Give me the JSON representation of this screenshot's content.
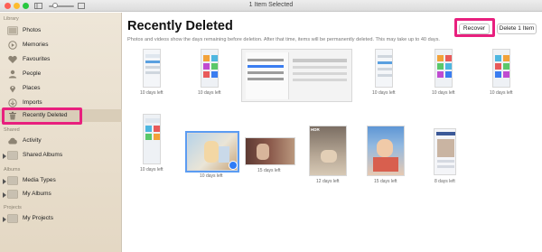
{
  "window": {
    "title": "1 Item Selected"
  },
  "sidebar": {
    "sections": {
      "library": "Library",
      "shared": "Shared",
      "albums": "Albums",
      "projects": "Projects"
    },
    "library_items": [
      {
        "label": "Photos",
        "icon": "photos-icon"
      },
      {
        "label": "Memories",
        "icon": "memories-icon"
      },
      {
        "label": "Favourites",
        "icon": "heart-icon"
      },
      {
        "label": "People",
        "icon": "people-icon"
      },
      {
        "label": "Places",
        "icon": "places-icon"
      },
      {
        "label": "Imports",
        "icon": "imports-icon"
      },
      {
        "label": "Recently Deleted",
        "icon": "trash-icon"
      }
    ],
    "shared_items": [
      {
        "label": "Activity",
        "icon": "cloud-icon"
      },
      {
        "label": "Shared Albums",
        "icon": "album-icon"
      }
    ],
    "album_items": [
      {
        "label": "Media Types",
        "icon": "album-icon"
      },
      {
        "label": "My Albums",
        "icon": "album-icon"
      }
    ],
    "project_items": [
      {
        "label": "My Projects",
        "icon": "album-icon"
      }
    ]
  },
  "main": {
    "title": "Recently Deleted",
    "subtitle": "Photos and videos show the days remaining before deletion. After that time, items will be permanently deleted. This may take up to 40 days.",
    "buttons": {
      "recover": "Recover",
      "delete": "Delete 1 Item"
    },
    "row1": [
      {
        "caption": "10 days left"
      },
      {
        "caption": "10 days left"
      },
      {
        "caption": ""
      },
      {
        "caption": "10 days left"
      },
      {
        "caption": "10 days left"
      },
      {
        "caption": "10 days left"
      }
    ],
    "row2": [
      {
        "caption": "10 days left"
      },
      {
        "caption": "10 days left",
        "selected": true
      },
      {
        "caption": "15 days left"
      },
      {
        "caption": "12 days left"
      },
      {
        "caption": "15 days left"
      },
      {
        "caption": "8 days left"
      }
    ],
    "hdr_badge": "HDR"
  },
  "colors": {
    "highlight": "#e8207e",
    "selection": "#2f7cf6",
    "sidebar_bg": "#eee6d8"
  }
}
